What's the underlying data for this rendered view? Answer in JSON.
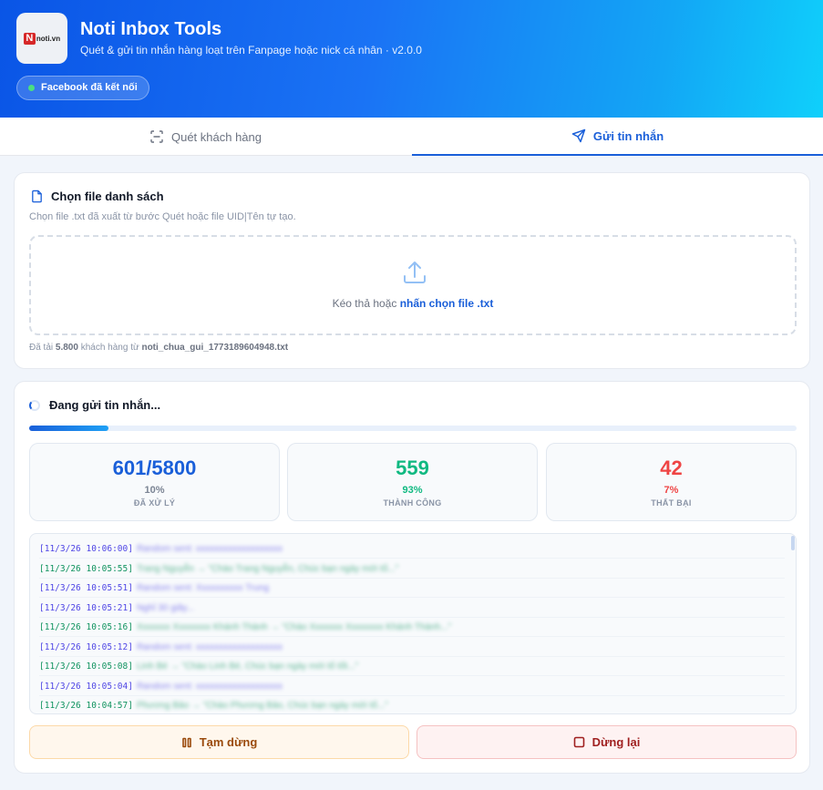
{
  "header": {
    "logo_icon": "notivn-logo-icon",
    "logo_n": "N",
    "logo_text": "noti.vn",
    "title": "Noti Inbox Tools",
    "subtitle": "Quét & gửi tin nhắn hàng loạt trên Fanpage hoặc nick cá nhân · v2.0.0",
    "status_badge": "Facebook đã kết nối"
  },
  "tabs": [
    {
      "label": "Quét khách hàng",
      "icon": "scan-icon",
      "active": false
    },
    {
      "label": "Gửi tin nhắn",
      "icon": "send-icon",
      "active": true
    }
  ],
  "file_card": {
    "title": "Chọn file danh sách",
    "description": "Chọn file .txt đã xuất từ bước Quét hoặc file UID|Tên tự tạo.",
    "dropzone_text": "Kéo thả hoặc ",
    "dropzone_link": "nhấn chọn file .txt",
    "loaded_prefix": "Đã tải ",
    "loaded_count": "5.800",
    "loaded_middle": " khách hàng từ ",
    "loaded_file": "noti_chua_gui_1773189604948.txt"
  },
  "sending": {
    "title": "Đang gửi tin nhắn...",
    "progress": 0.1036,
    "stats": [
      {
        "value": "601/5800",
        "percent": "10%",
        "label": "ĐÃ XỬ LÝ",
        "color": "#1a5fd9"
      },
      {
        "value": "559",
        "percent": "93%",
        "label": "THÀNH CÔNG",
        "color": "#10b981"
      },
      {
        "value": "42",
        "percent": "7%",
        "label": "THẤT BẠI",
        "color": "#ef4444"
      }
    ],
    "log": [
      {
        "time": "[11/3/26 10:06:00]",
        "msg": "Random sent: xxxxxxxxxxxxxxxxxxx",
        "type": "info"
      },
      {
        "time": "[11/3/26 10:05:55]",
        "msg": "Trang Nguyễn → \"Chào Trang Nguyễn, Chúc bạn ngày mới tố...\"",
        "type": "ok"
      },
      {
        "time": "[11/3/26 10:05:51]",
        "msg": "Random sent: Xxxxxxxxxx Trung",
        "type": "info"
      },
      {
        "time": "[11/3/26 10:05:21]",
        "msg": "Nghỉ 30 giây...",
        "type": "info"
      },
      {
        "time": "[11/3/26 10:05:16]",
        "msg": "Xxxxxxx Xxxxxxxx Khánh Thành → \"Chào Xxxxxxx Xxxxxxxx Khánh Thành...\"",
        "type": "ok"
      },
      {
        "time": "[11/3/26 10:05:12]",
        "msg": "Random sent: xxxxxxxxxxxxxxxxxxx",
        "type": "info"
      },
      {
        "time": "[11/3/26 10:05:08]",
        "msg": "Linh Bé → \"Chào Linh Bé, Chúc bạn ngày mới tố tốt...\"",
        "type": "ok"
      },
      {
        "time": "[11/3/26 10:05:04]",
        "msg": "Random sent: xxxxxxxxxxxxxxxxxxx",
        "type": "info"
      },
      {
        "time": "[11/3/26 10:04:57]",
        "msg": "Phương Bảo → \"Chào Phương Bảo, Chúc bạn ngày mới tố...\"",
        "type": "ok"
      }
    ]
  },
  "buttons": {
    "pause_label": "Tạm dừng",
    "pause_icon": "pause-icon",
    "stop_label": "Dừng lại",
    "stop_icon": "stop-square-icon"
  },
  "icons": {
    "file": "file-icon",
    "upload": "upload-icon",
    "spinner": "spinner-icon"
  },
  "colors": {
    "accent": "#1a5fd9",
    "success": "#10b981",
    "danger": "#ef4444",
    "connected": "#4ade80"
  }
}
